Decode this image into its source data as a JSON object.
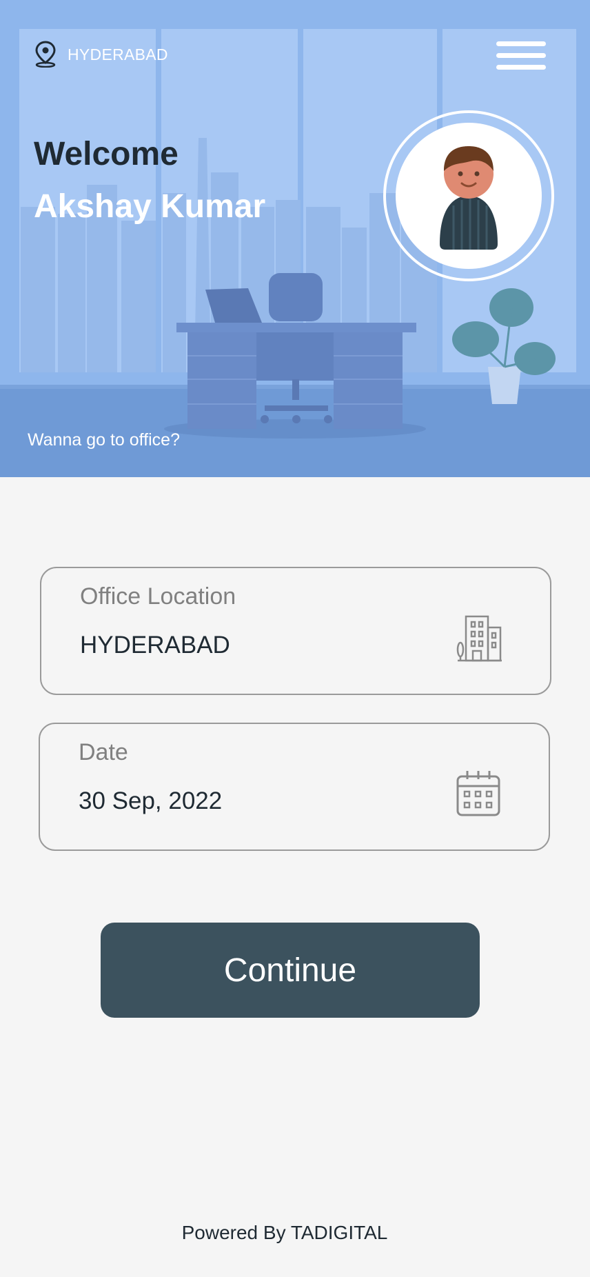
{
  "header": {
    "location_icon": "map-pin-icon",
    "location": "HYDERABAD",
    "menu_icon": "hamburger-menu-icon"
  },
  "hero": {
    "greeting": "Welcome",
    "user_name": "Akshay Kumar",
    "question": "Wanna go to office?",
    "avatar_icon": "user-avatar-icon",
    "colors": {
      "sky": "#8eb6ec",
      "floor": "#6f9ad6",
      "text_dark": "#1f2a33"
    }
  },
  "form": {
    "office": {
      "label": "Office Location",
      "value": "HYDERABAD",
      "icon": "office-building-icon"
    },
    "date": {
      "label": "Date",
      "value": "30 Sep, 2022",
      "icon": "calendar-icon"
    }
  },
  "actions": {
    "continue_label": "Continue",
    "continue_color": "#3c525e"
  },
  "footer": {
    "text": "Powered By TADIGITAL"
  }
}
